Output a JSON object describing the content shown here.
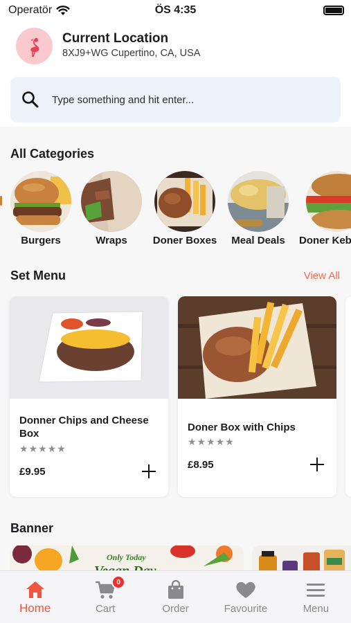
{
  "status_bar": {
    "carrier": "Operatör",
    "time": "ÖS 4:35",
    "battery_level": 1.0
  },
  "location": {
    "title": "Current Location",
    "address": "8XJ9+WG Cupertino, CA, USA",
    "avatar_icon": "flamingo-icon"
  },
  "search": {
    "placeholder": "Type something and hit enter..."
  },
  "categories_section": {
    "title": "All Categories"
  },
  "categories": [
    {
      "label": "Burgers"
    },
    {
      "label": "Wraps"
    },
    {
      "label": "Doner Boxes"
    },
    {
      "label": "Meal Deals"
    },
    {
      "label": "Doner Kebab"
    }
  ],
  "set_menu": {
    "title": "Set Menu",
    "view_all": "View All",
    "items": [
      {
        "name": "Donner Chips and Cheese Box",
        "rating": 0,
        "max_rating": 5,
        "price": "£9.95"
      },
      {
        "name": "Doner Box with Chips",
        "rating": 0,
        "max_rating": 5,
        "price": "£8.95"
      }
    ]
  },
  "banner_section": {
    "title": "Banner",
    "banner_text": "Only Today",
    "banner_text_2": "Vegan Day"
  },
  "tabs": [
    {
      "label": "Home",
      "icon": "home-icon",
      "active": true
    },
    {
      "label": "Cart",
      "icon": "cart-icon",
      "badge": "0"
    },
    {
      "label": "Order",
      "icon": "bag-icon"
    },
    {
      "label": "Favourite",
      "icon": "heart-icon"
    },
    {
      "label": "Menu",
      "icon": "hamburger-menu-icon"
    }
  ],
  "colors": {
    "accent": "#f0553f",
    "view_all": "#f26a4b",
    "search_bg": "#eef3fb",
    "avatar_bg": "#f9c9ce",
    "badge": "#e8312a"
  }
}
